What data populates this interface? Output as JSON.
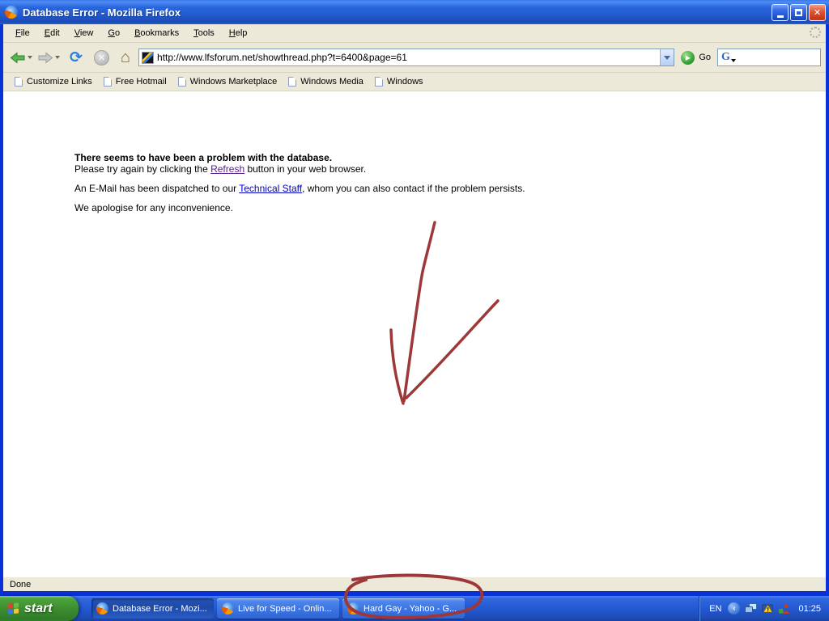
{
  "window": {
    "title": "Database Error - Mozilla Firefox",
    "status": "Done"
  },
  "menubar": {
    "items": [
      "File",
      "Edit",
      "View",
      "Go",
      "Bookmarks",
      "Tools",
      "Help"
    ]
  },
  "navbar": {
    "url": "http://www.lfsforum.net/showthread.php?t=6400&page=61",
    "go_label": "Go",
    "search_value": ""
  },
  "bookmarks_bar": {
    "items": [
      "Customize Links",
      "Free Hotmail",
      "Windows Marketplace",
      "Windows Media",
      "Windows"
    ]
  },
  "page": {
    "heading": "There seems to have been a problem with the database.",
    "line1_pre": "Please try again by clicking the ",
    "refresh_link": "Refresh",
    "line1_post": " button in your web browser.",
    "line2_pre": "An E-Mail has been dispatched to our ",
    "staff_link": "Technical Staff",
    "line2_post": ", whom you can also contact if the problem persists.",
    "apology": "We apologise for any inconvenience.",
    "visited_link_color": "#551a8b",
    "link_color": "#0000cc"
  },
  "taskbar": {
    "start_label": "start",
    "buttons": [
      {
        "label": "Database Error - Mozi...",
        "active": true
      },
      {
        "label": "Live for Speed - Onlin...",
        "active": false
      },
      {
        "label": "Hard Gay - Yahoo - G...",
        "active": false
      }
    ],
    "tray": {
      "language": "EN",
      "clock": "01:25"
    }
  },
  "annotations": {
    "color": "#9d3838"
  }
}
